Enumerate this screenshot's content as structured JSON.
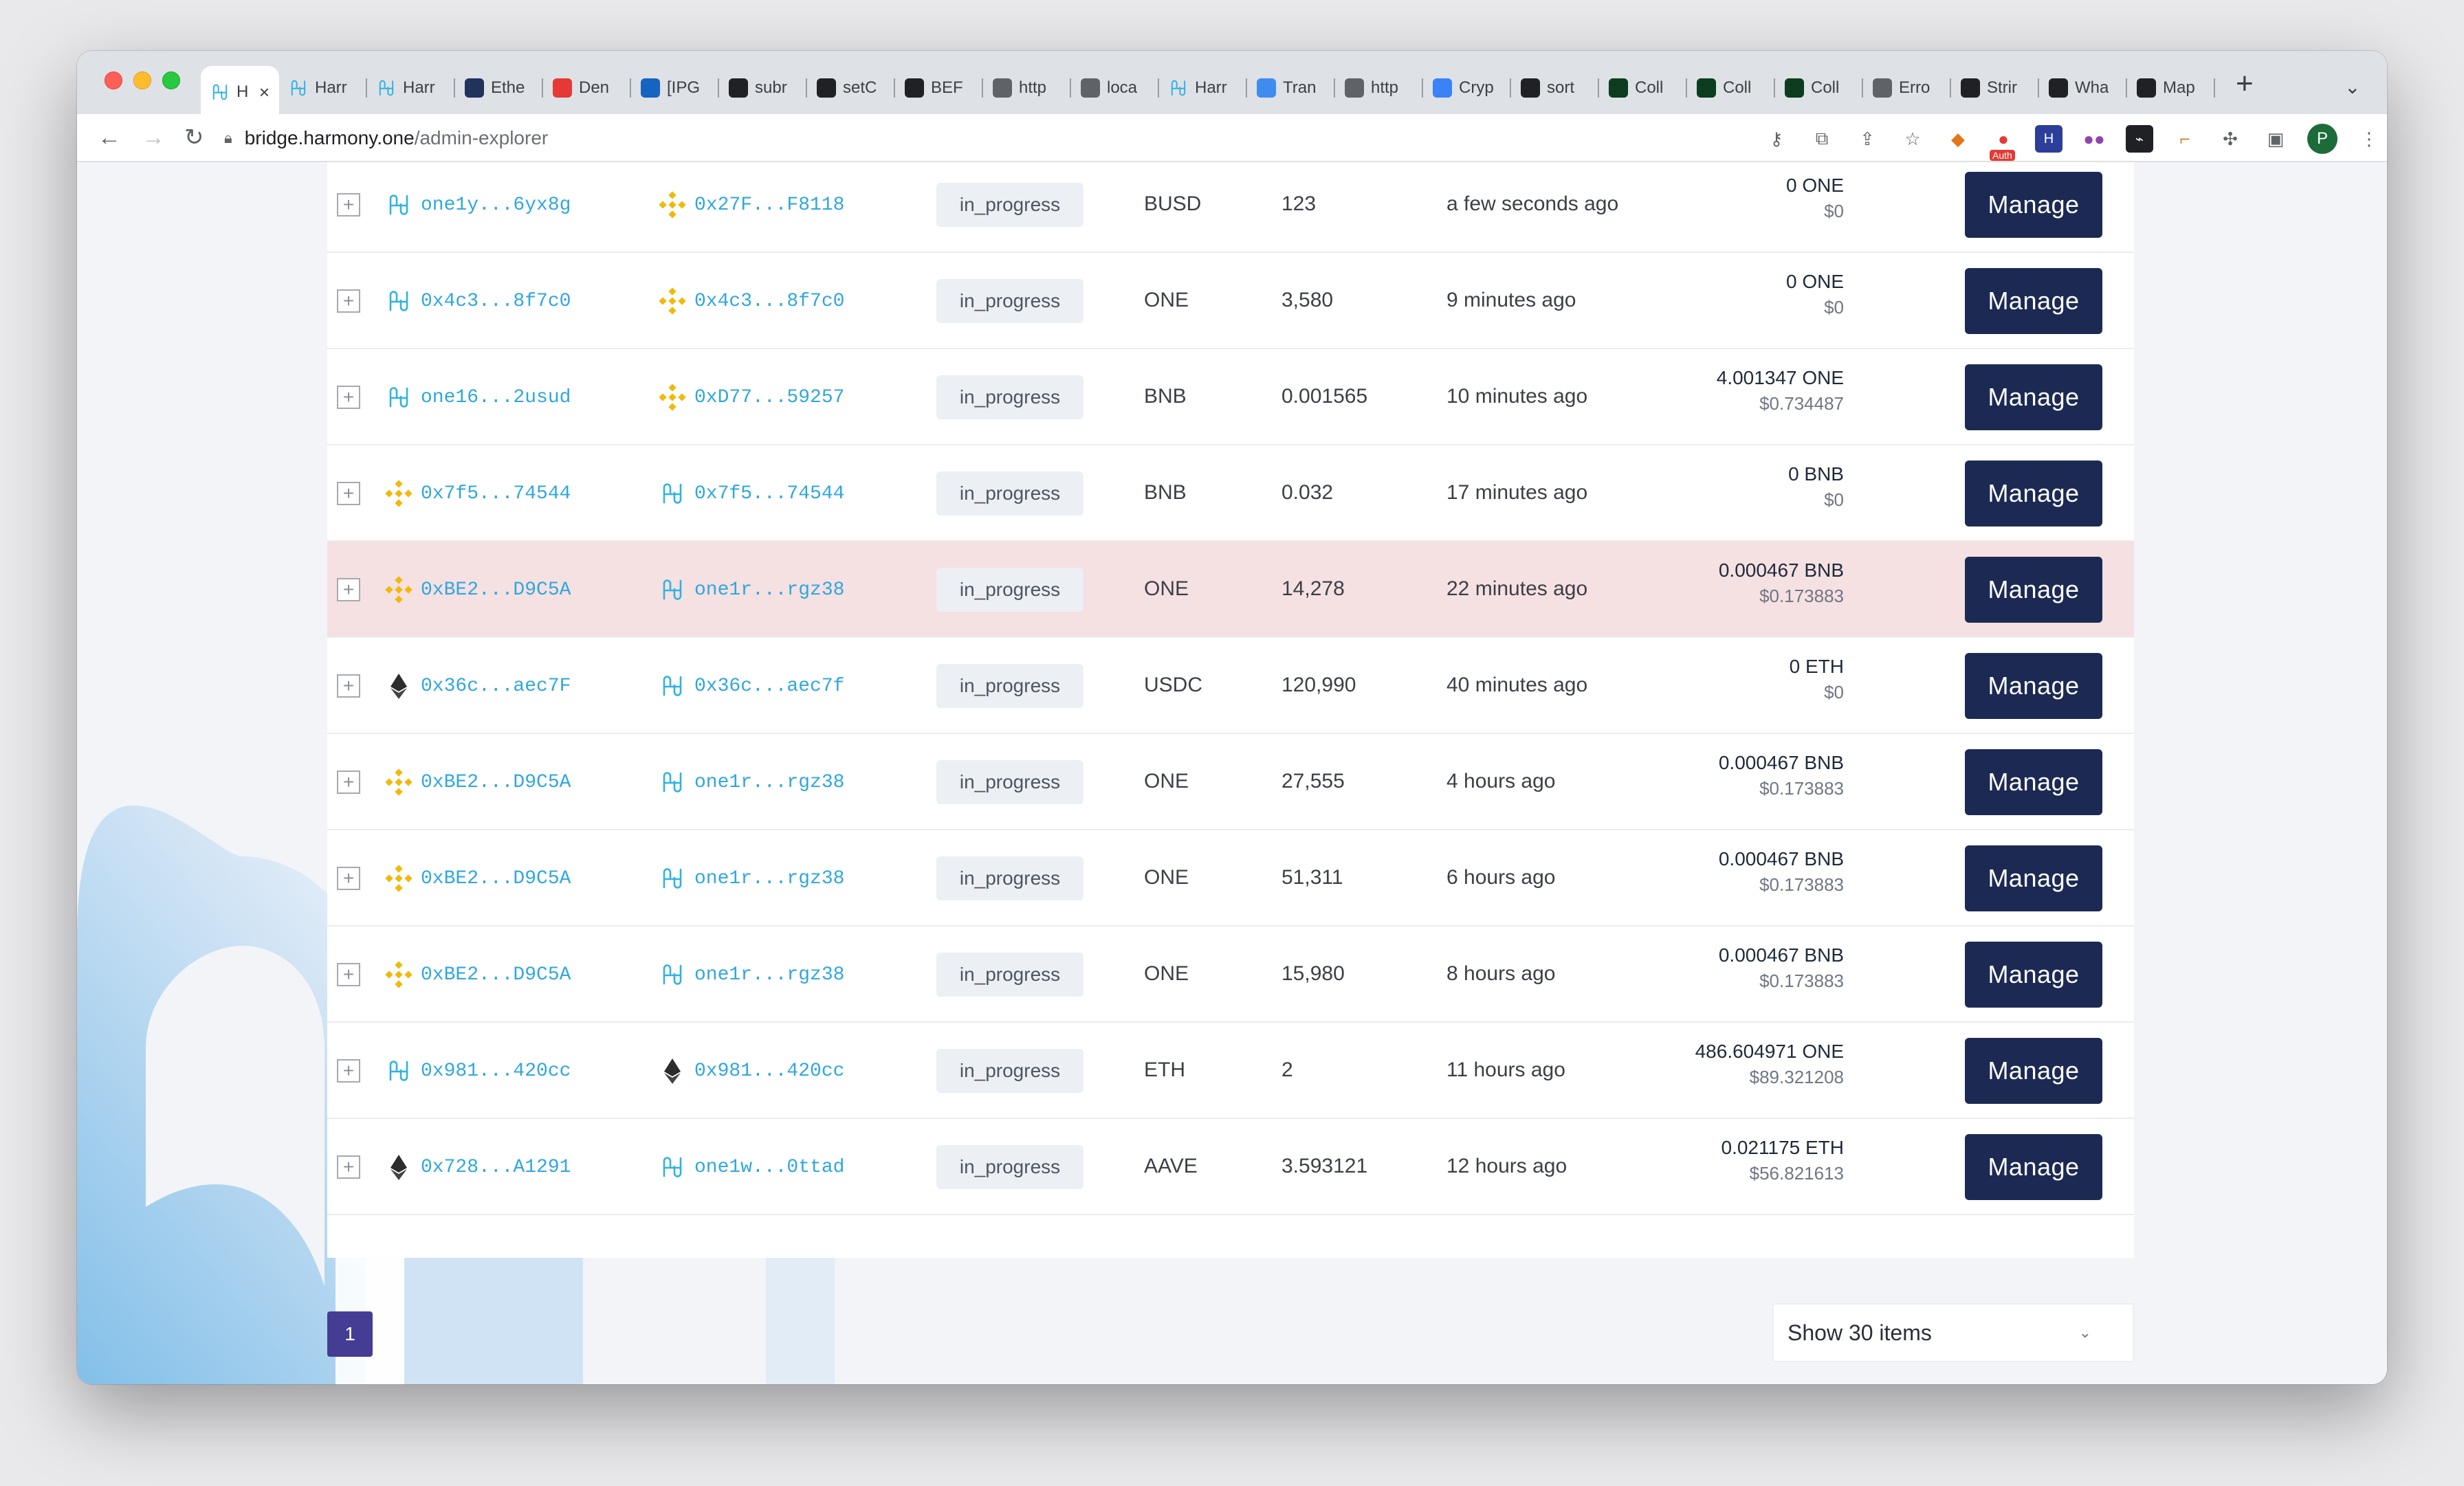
{
  "browser": {
    "tabs": [
      {
        "label": "H",
        "favicon": "harmony-icon",
        "color": "#00aee9",
        "active": true
      },
      {
        "label": "Harr",
        "favicon": "harmony-icon",
        "color": "#00aee9"
      },
      {
        "label": "Harr",
        "favicon": "harmony-icon",
        "color": "#00aee9"
      },
      {
        "label": "Ethe",
        "favicon": "etherscan-icon",
        "color": "#21325b"
      },
      {
        "label": "Den",
        "favicon": "globe-icon",
        "color": "#e53935"
      },
      {
        "label": "[IPG",
        "favicon": "flag-icon",
        "color": "#1565c0"
      },
      {
        "label": "subr",
        "favicon": "tent-icon",
        "color": "#202124"
      },
      {
        "label": "setC",
        "favicon": "tent-icon",
        "color": "#202124"
      },
      {
        "label": "BEF",
        "favicon": "tent-icon",
        "color": "#202124"
      },
      {
        "label": "http",
        "favicon": "globe-icon",
        "color": "#5f6368"
      },
      {
        "label": "loca",
        "favicon": "globe-icon",
        "color": "#5f6368"
      },
      {
        "label": "Harr",
        "favicon": "harmony-icon",
        "color": "#00aee9"
      },
      {
        "label": "Tran",
        "favicon": "cube-icon",
        "color": "#3f8cf0"
      },
      {
        "label": "http",
        "favicon": "globe-icon",
        "color": "#5f6368"
      },
      {
        "label": "Cryp",
        "favicon": "coin-icon",
        "color": "#3b82f6"
      },
      {
        "label": "sort",
        "favicon": "github-icon",
        "color": "#202124"
      },
      {
        "label": "Coll",
        "favicon": "leaf-icon",
        "color": "#0b3d1e"
      },
      {
        "label": "Coll",
        "favicon": "leaf-icon",
        "color": "#0b3d1e"
      },
      {
        "label": "Coll",
        "favicon": "leaf-icon",
        "color": "#0b3d1e"
      },
      {
        "label": "Erro",
        "favicon": "globe-icon",
        "color": "#5f6368"
      },
      {
        "label": "Strir",
        "favicon": "square-icon",
        "color": "#202124"
      },
      {
        "label": "Wha",
        "favicon": "person-icon",
        "color": "#202124"
      },
      {
        "label": "Map",
        "favicon": "wikipedia-icon",
        "color": "#202124"
      }
    ],
    "url_host": "bridge.harmony.one",
    "url_path": "/admin-explorer",
    "avatar_initial": "P",
    "auth_badge": "Auth"
  },
  "operations": [
    {
      "from_chain": "harmony",
      "from": "one1y...6yx8g",
      "to_chain": "bsc",
      "to": "0x27F...F8118",
      "status": "in_progress",
      "token": "BUSD",
      "amount": "123",
      "time": "a few seconds ago",
      "fee": "0 ONE",
      "fee_usd": "$0"
    },
    {
      "from_chain": "harmony",
      "from": "0x4c3...8f7c0",
      "to_chain": "bsc",
      "to": "0x4c3...8f7c0",
      "status": "in_progress",
      "token": "ONE",
      "amount": "3,580",
      "time": "9 minutes ago",
      "fee": "0 ONE",
      "fee_usd": "$0"
    },
    {
      "from_chain": "harmony",
      "from": "one16...2usud",
      "to_chain": "bsc",
      "to": "0xD77...59257",
      "status": "in_progress",
      "token": "BNB",
      "amount": "0.001565",
      "time": "10 minutes ago",
      "fee": "4.001347 ONE",
      "fee_usd": "$0.734487"
    },
    {
      "from_chain": "bsc",
      "from": "0x7f5...74544",
      "to_chain": "harmony",
      "to": "0x7f5...74544",
      "status": "in_progress",
      "token": "BNB",
      "amount": "0.032",
      "time": "17 minutes ago",
      "fee": "0 BNB",
      "fee_usd": "$0"
    },
    {
      "from_chain": "bsc",
      "from": "0xBE2...D9C5A",
      "to_chain": "harmony",
      "to": "one1r...rgz38",
      "status": "in_progress",
      "token": "ONE",
      "amount": "14,278",
      "time": "22 minutes ago",
      "fee": "0.000467 BNB",
      "fee_usd": "$0.173883",
      "highlight": true
    },
    {
      "from_chain": "ethereum",
      "from": "0x36c...aec7F",
      "to_chain": "harmony",
      "to": "0x36c...aec7f",
      "status": "in_progress",
      "token": "USDC",
      "amount": "120,990",
      "time": "40 minutes ago",
      "fee": "0 ETH",
      "fee_usd": "$0"
    },
    {
      "from_chain": "bsc",
      "from": "0xBE2...D9C5A",
      "to_chain": "harmony",
      "to": "one1r...rgz38",
      "status": "in_progress",
      "token": "ONE",
      "amount": "27,555",
      "time": "4 hours ago",
      "fee": "0.000467 BNB",
      "fee_usd": "$0.173883"
    },
    {
      "from_chain": "bsc",
      "from": "0xBE2...D9C5A",
      "to_chain": "harmony",
      "to": "one1r...rgz38",
      "status": "in_progress",
      "token": "ONE",
      "amount": "51,311",
      "time": "6 hours ago",
      "fee": "0.000467 BNB",
      "fee_usd": "$0.173883"
    },
    {
      "from_chain": "bsc",
      "from": "0xBE2...D9C5A",
      "to_chain": "harmony",
      "to": "one1r...rgz38",
      "status": "in_progress",
      "token": "ONE",
      "amount": "15,980",
      "time": "8 hours ago",
      "fee": "0.000467 BNB",
      "fee_usd": "$0.173883"
    },
    {
      "from_chain": "harmony",
      "from": "0x981...420cc",
      "to_chain": "ethereum",
      "to": "0x981...420cc",
      "status": "in_progress",
      "token": "ETH",
      "amount": "2",
      "time": "11 hours ago",
      "fee": "486.604971 ONE",
      "fee_usd": "$89.321208"
    },
    {
      "from_chain": "ethereum",
      "from": "0x728...A1291",
      "to_chain": "harmony",
      "to": "one1w...0ttad",
      "status": "in_progress",
      "token": "AAVE",
      "amount": "3.593121",
      "time": "12 hours ago",
      "fee": "0.021175 ETH",
      "fee_usd": "$56.821613"
    }
  ],
  "manage_label": "Manage",
  "pagination": {
    "current_page": "1",
    "page_size_label": "Show 30 items"
  },
  "colors": {
    "manage_bg": "#1c2a53",
    "address": "#2fa7de",
    "highlight_row": "#f5e0e2",
    "page_btn": "#453d94"
  }
}
